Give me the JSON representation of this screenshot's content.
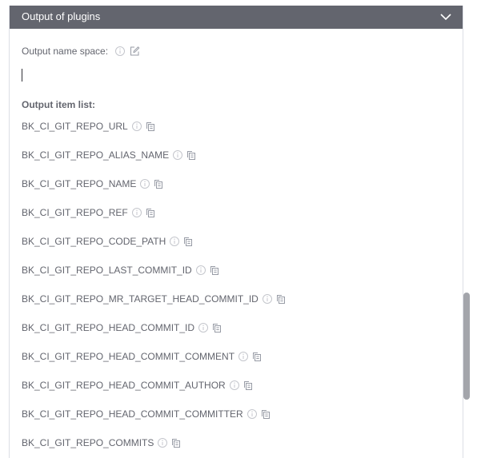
{
  "panel": {
    "title": "Output of plugins",
    "header_color": "#63656e"
  },
  "namespace": {
    "label": "Output name space",
    "colon": ":",
    "value": ""
  },
  "output_list": {
    "title": "Output item list:",
    "items": [
      "BK_CI_GIT_REPO_URL",
      "BK_CI_GIT_REPO_ALIAS_NAME",
      "BK_CI_GIT_REPO_NAME",
      "BK_CI_GIT_REPO_REF",
      "BK_CI_GIT_REPO_CODE_PATH",
      "BK_CI_GIT_REPO_LAST_COMMIT_ID",
      "BK_CI_GIT_REPO_MR_TARGET_HEAD_COMMIT_ID",
      "BK_CI_GIT_REPO_HEAD_COMMIT_ID",
      "BK_CI_GIT_REPO_HEAD_COMMIT_COMMENT",
      "BK_CI_GIT_REPO_HEAD_COMMIT_AUTHOR",
      "BK_CI_GIT_REPO_HEAD_COMMIT_COMMITTER",
      "BK_CI_GIT_REPO_COMMITS"
    ]
  },
  "icons": {
    "info": "info-icon",
    "edit": "edit-icon",
    "copy": "copy-icon",
    "collapse": "chevron-down-icon"
  }
}
